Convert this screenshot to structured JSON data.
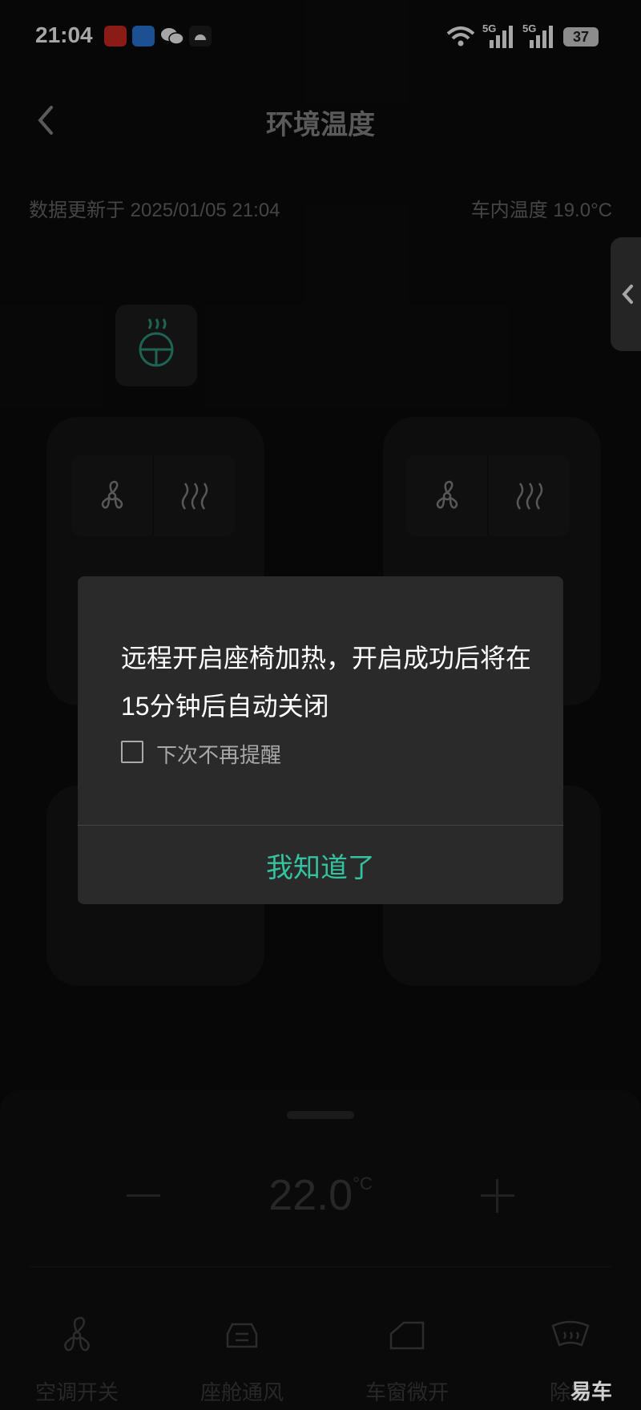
{
  "status_bar": {
    "time": "21:04",
    "network_1": "5G",
    "network_2": "5G",
    "battery": "37",
    "icons": [
      "app-icon-red",
      "app-icon-blue",
      "wechat-icon",
      "android-icon",
      "wifi-icon",
      "signal-icon",
      "battery-icon"
    ]
  },
  "header": {
    "title": "环境温度"
  },
  "meta": {
    "updated": "数据更新于 2025/01/05 21:04",
    "cabin_temp": "车内温度 19.0°C"
  },
  "dialog": {
    "message": "远程开启座椅加热，开启成功后将在15分钟后自动关闭",
    "checkbox_label": "下次不再提醒",
    "confirm": "我知道了",
    "accent_color": "#33c3a0"
  },
  "panel": {
    "temperature": "22.0",
    "temperature_unit": "°C",
    "items": [
      {
        "label": "空调开关",
        "icon": "fan-icon"
      },
      {
        "label": "座舱通风",
        "icon": "cabin-vent-icon"
      },
      {
        "label": "车窗微开",
        "icon": "window-icon"
      },
      {
        "label": "除霜",
        "icon": "defrost-icon"
      }
    ]
  },
  "watermark": "易车"
}
